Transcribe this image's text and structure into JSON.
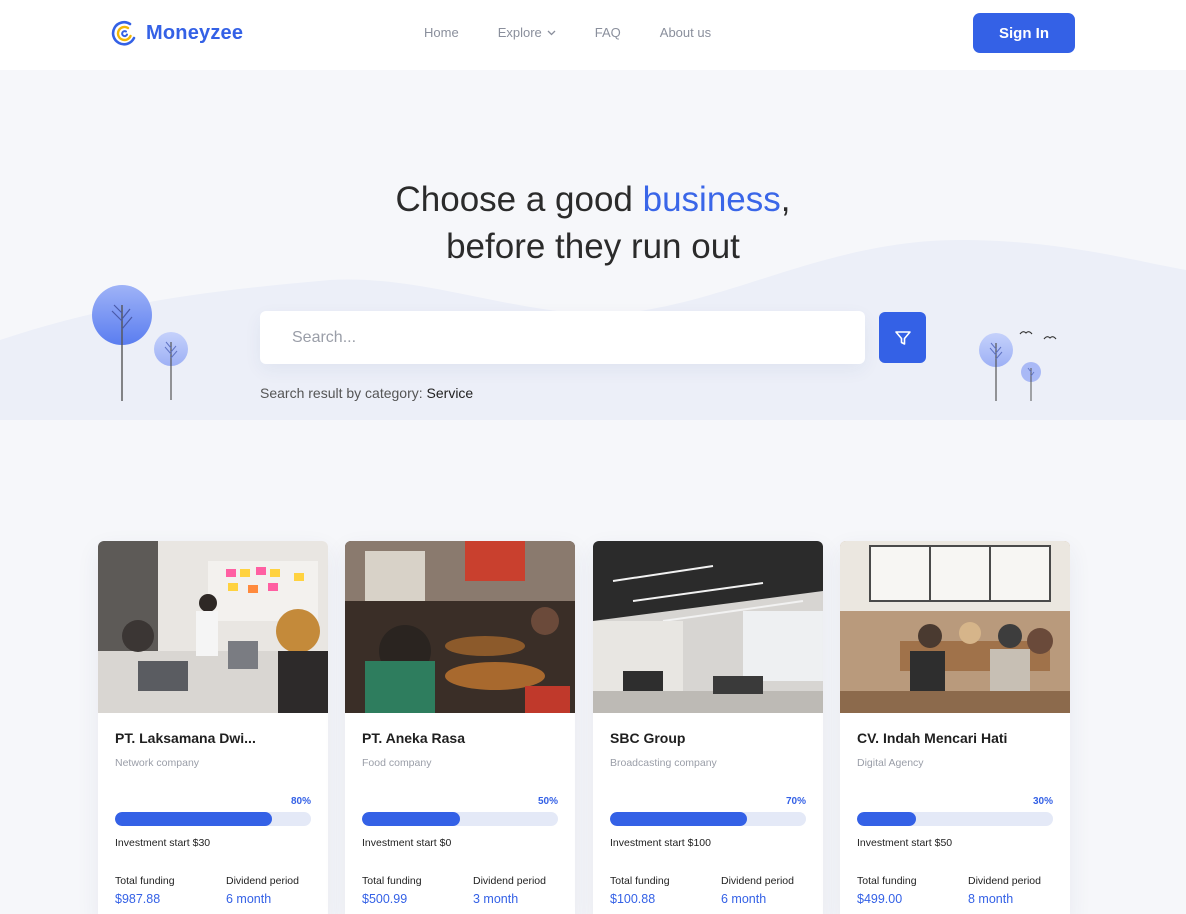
{
  "header": {
    "logo_text": "Moneyzee",
    "nav": [
      {
        "label": "Home"
      },
      {
        "label": "Explore"
      },
      {
        "label": "FAQ"
      },
      {
        "label": "About us"
      }
    ],
    "signin_label": "Sign In"
  },
  "hero": {
    "title_part1": "Choose a good ",
    "title_accent": "business",
    "title_part2": ",",
    "title_line2": "before they run out",
    "search_placeholder": "Search...",
    "result_prefix": "Search result by category: ",
    "result_category": "Service"
  },
  "colors": {
    "accent": "#3461e6",
    "bar_track": "#e4e9f7",
    "background": "#f6f7fa"
  },
  "cards": [
    {
      "name": "PT. Laksamana Dwi...",
      "type": "Network company",
      "progress_percent": 80,
      "progress_label": "80%",
      "investment": "Investment start $30",
      "funding_label": "Total funding",
      "funding_value": "$987.88",
      "dividend_label": "Dividend period",
      "dividend_value": "6 month",
      "image": "office-meeting-photo"
    },
    {
      "name": "PT. Aneka Rasa",
      "type": "Food company",
      "progress_percent": 50,
      "progress_label": "50%",
      "investment": "Investment start $0",
      "funding_label": "Total funding",
      "funding_value": "$500.99",
      "dividend_label": "Dividend period",
      "dividend_value": "3 month",
      "image": "bakery-cafe-photo"
    },
    {
      "name": "SBC Group",
      "type": "Broadcasting company",
      "progress_percent": 70,
      "progress_label": "70%",
      "investment": "Investment start $100",
      "funding_label": "Total funding",
      "funding_value": "$100.88",
      "dividend_label": "Dividend period",
      "dividend_value": "6 month",
      "image": "open-office-photo"
    },
    {
      "name": "CV. Indah Mencari Hati",
      "type": "Digital Agency",
      "progress_percent": 30,
      "progress_label": "30%",
      "investment": "Investment start $50",
      "funding_label": "Total funding",
      "funding_value": "$499.00",
      "dividend_label": "Dividend period",
      "dividend_value": "8 month",
      "image": "team-table-photo"
    }
  ]
}
